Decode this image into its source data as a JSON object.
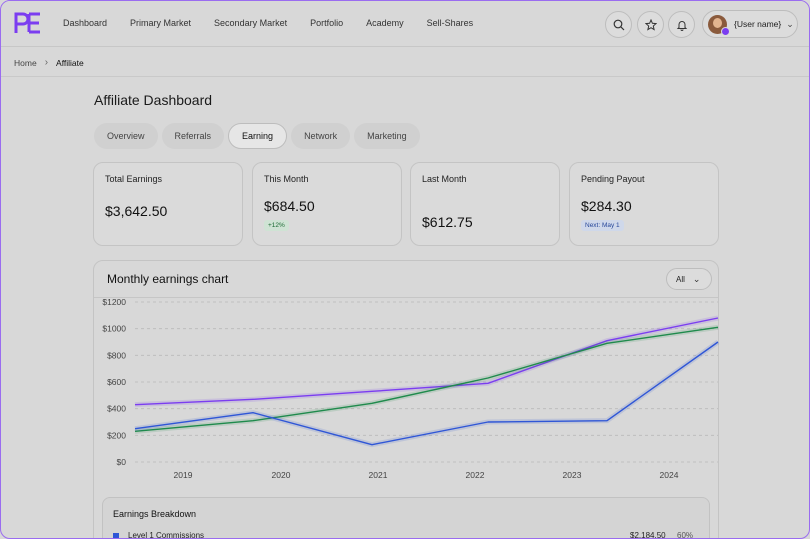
{
  "header": {
    "nav": [
      "Dashboard",
      "Primary Market",
      "Secondary Market",
      "Portfolio",
      "Academy",
      "Sell-Shares"
    ],
    "user_name": "{User name}",
    "icons": [
      "search-icon",
      "star-icon",
      "bell-icon"
    ],
    "brand_color": "#7b3df0"
  },
  "breadcrumb": {
    "home": "Home",
    "current": "Affiliate"
  },
  "page": {
    "title": "Affiliate Dashboard",
    "tabs": [
      "Overview",
      "Referrals",
      "Earning",
      "Network",
      "Marketing"
    ],
    "active_tab": "Earning"
  },
  "stats": [
    {
      "label": "Total Earnings",
      "value": "$3,642.50"
    },
    {
      "label": "This Month",
      "value": "$684.50",
      "chip": "+12%"
    },
    {
      "label": "Last Month",
      "value": "$612.75"
    },
    {
      "label": "Pending Payout",
      "value": "$284.30",
      "chip": "Next: May 1"
    }
  ],
  "chart": {
    "title": "Monthly earnings chart",
    "filter": "All"
  },
  "chart_data": {
    "type": "line",
    "x": [
      "2018.5",
      "2019.7",
      "2021",
      "2022.2",
      "2023.4",
      "2024.5"
    ],
    "x_ticks": [
      "2019",
      "2020",
      "2021",
      "2022",
      "2023",
      "2024"
    ],
    "y_ticks": [
      "$0",
      "$200",
      "$400",
      "$600",
      "$800",
      "$1000",
      "$1200"
    ],
    "ylim": [
      0,
      1200
    ],
    "series": [
      {
        "color": "#7b3df0",
        "values": [
          430,
          470,
          530,
          590,
          910,
          1080
        ]
      },
      {
        "color": "#1f8a4c",
        "values": [
          230,
          310,
          440,
          630,
          890,
          1010
        ]
      },
      {
        "color": "#2f56d6",
        "values": [
          250,
          370,
          130,
          300,
          310,
          900
        ]
      }
    ]
  },
  "breakdown": {
    "title": "Earnings Breakdown",
    "rows": [
      {
        "label": "Level 1 Commissions",
        "amount": "$2,184.50",
        "pct": "60%",
        "color": "#2f56d6"
      }
    ]
  }
}
